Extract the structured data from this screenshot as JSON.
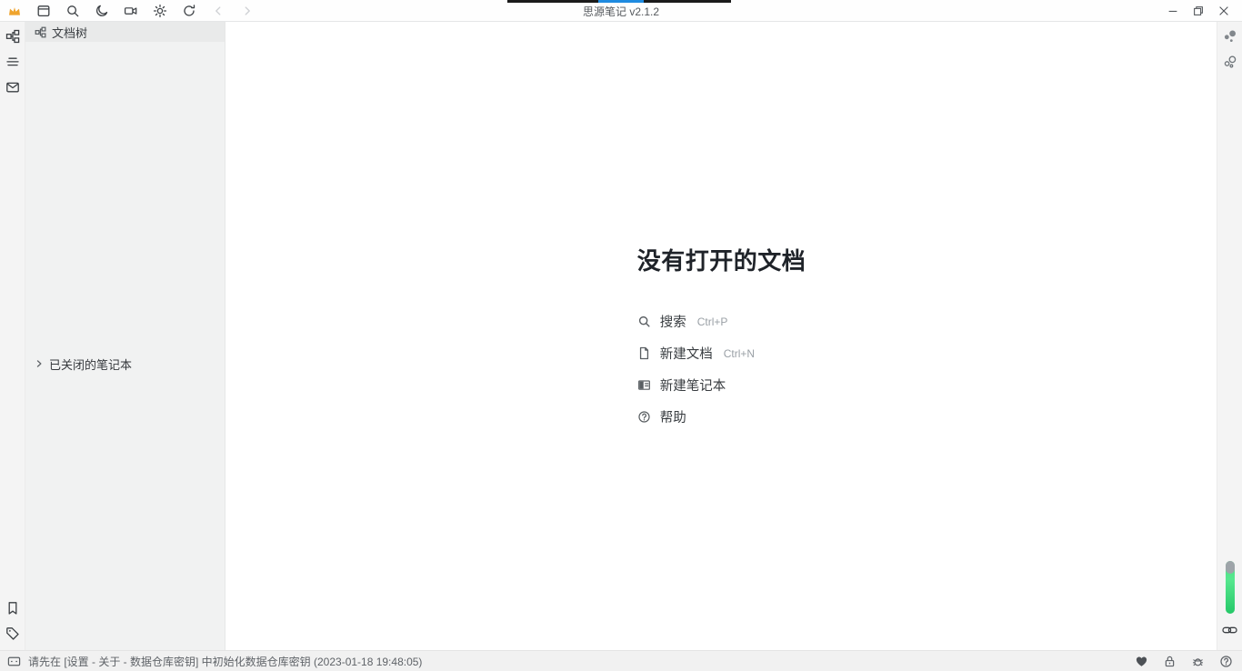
{
  "titlebar": {
    "title": "思源笔记 v2.1.2",
    "left_icons": [
      "crown-icon",
      "daily-note-icon",
      "search-icon",
      "theme-moon-icon",
      "record-icon",
      "settings-icon",
      "sync-icon",
      "back-icon",
      "forward-icon"
    ],
    "window_controls": [
      "minimize-icon",
      "maximize-icon",
      "close-icon"
    ]
  },
  "left_dock": {
    "top_icons": [
      "file-tree-icon",
      "outline-icon",
      "inbox-icon"
    ],
    "bottom_icons": [
      "bookmark-icon",
      "tag-icon"
    ]
  },
  "right_dock": {
    "top_icons": [
      "graph-icon",
      "global-graph-icon"
    ],
    "bottom_items": [
      "vertical-slider",
      "backlinks-link-icon"
    ]
  },
  "sidebar": {
    "header": "文档树",
    "closed_notebooks_label": "已关闭的笔记本"
  },
  "main": {
    "empty_heading": "没有打开的文档",
    "actions": [
      {
        "icon": "search-icon",
        "label": "搜索",
        "shortcut": "Ctrl+P"
      },
      {
        "icon": "new-doc-icon",
        "label": "新建文档",
        "shortcut": "Ctrl+N"
      },
      {
        "icon": "new-notebook-icon",
        "label": "新建笔记本",
        "shortcut": ""
      },
      {
        "icon": "help-icon",
        "label": "帮助",
        "shortcut": ""
      }
    ]
  },
  "statusbar": {
    "message": "请先在 [设置 - 关于 - 数据仓库密钥] 中初始化数据仓库密钥 (2023-01-18 19:48:05)",
    "right_icons": [
      "heart-icon",
      "lock-icon",
      "bug-icon",
      "help-circle-icon"
    ]
  },
  "colors": {
    "crown_amber": "#efa42d",
    "progress_track": "#1b1b1b",
    "progress_indicator": "#1f8be0",
    "slider_green_top": "#4fe086",
    "slider_green_bottom": "#25c868",
    "icon_gray": "#5a5f63",
    "surface_gray": "#f1f2f2"
  }
}
